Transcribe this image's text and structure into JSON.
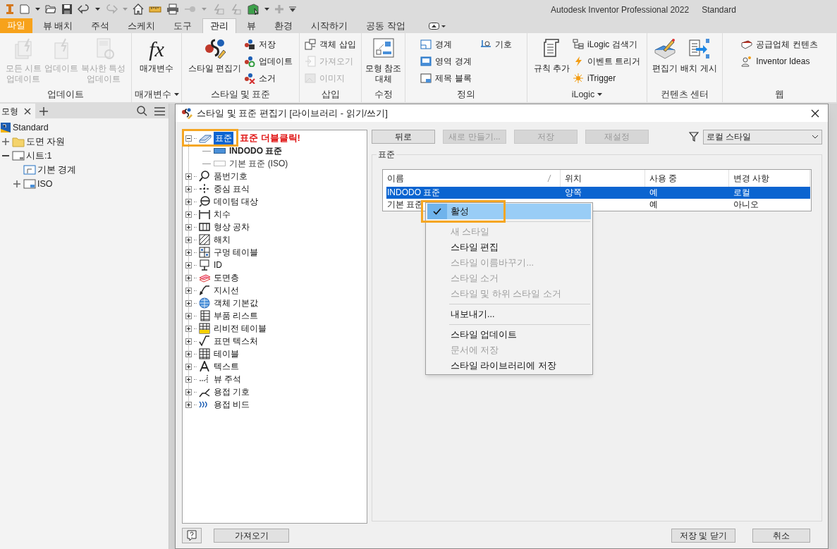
{
  "window": {
    "title": "Autodesk Inventor Professional 2022",
    "document": "Standard"
  },
  "ribbon": {
    "tabs": [
      {
        "label": "파일",
        "kind": "file",
        "selected": false
      },
      {
        "label": "뷰 배치",
        "kind": "tab",
        "selected": false
      },
      {
        "label": "주석",
        "kind": "tab",
        "selected": false
      },
      {
        "label": "스케치",
        "kind": "tab",
        "selected": false
      },
      {
        "label": "도구",
        "kind": "tab",
        "selected": false
      },
      {
        "label": "관리",
        "kind": "tab",
        "selected": true
      },
      {
        "label": "뷰",
        "kind": "tab",
        "selected": false
      },
      {
        "label": "환경",
        "kind": "tab",
        "selected": false
      },
      {
        "label": "시작하기",
        "kind": "tab",
        "selected": false
      },
      {
        "label": "공동 작업",
        "kind": "tab",
        "selected": false
      }
    ],
    "panels": [
      {
        "title": "업데이트",
        "dropdown": false,
        "tools": [
          {
            "label": "모든 시트\n업데이트",
            "kind": "large",
            "disabled": true
          },
          {
            "label": "업데이트",
            "kind": "large",
            "disabled": true
          },
          {
            "label": "복사한 특성\n업데이트",
            "kind": "large",
            "disabled": true
          }
        ]
      },
      {
        "title": "매개변수",
        "dropdown": true,
        "tools": [
          {
            "label": "매개변수",
            "kind": "large",
            "disabled": false,
            "icon_text": "fx"
          }
        ]
      },
      {
        "title": "스타일 및 표준",
        "dropdown": false,
        "tools": [
          {
            "label": "스타일 편집기",
            "kind": "large",
            "disabled": false
          },
          {
            "label": "저장",
            "kind": "small",
            "disabled": false
          },
          {
            "label": "업데이트",
            "kind": "small",
            "disabled": false
          },
          {
            "label": "소거",
            "kind": "small",
            "disabled": false
          }
        ]
      },
      {
        "title": "삽입",
        "dropdown": false,
        "tools": [
          {
            "label": "객체 삽입",
            "kind": "small",
            "disabled": false
          },
          {
            "label": "가져오기",
            "kind": "small",
            "disabled": true
          },
          {
            "label": "이미지",
            "kind": "small",
            "disabled": true
          }
        ]
      },
      {
        "title": "수정",
        "dropdown": false,
        "tools": [
          {
            "label": "모형 참조\n대체",
            "kind": "large",
            "disabled": false
          }
        ]
      },
      {
        "title": "정의",
        "dropdown": false,
        "tools": [
          {
            "label": "경계",
            "kind": "small",
            "disabled": false
          },
          {
            "label": "영역 경계",
            "kind": "small",
            "disabled": false
          },
          {
            "label": "제목 블록",
            "kind": "small",
            "disabled": false
          },
          {
            "label": "기호",
            "kind": "small",
            "disabled": false
          }
        ]
      },
      {
        "title": "iLogic",
        "dropdown": true,
        "tools": [
          {
            "label": "규칙 추가",
            "kind": "large",
            "disabled": false
          },
          {
            "label": "iLogic 검색기",
            "kind": "small",
            "disabled": false
          },
          {
            "label": "이벤트 트리거",
            "kind": "small",
            "disabled": false
          },
          {
            "label": "iTrigger",
            "kind": "small",
            "disabled": false
          }
        ]
      },
      {
        "title": "컨텐츠 센터",
        "dropdown": false,
        "tools": [
          {
            "label": "편집기",
            "kind": "large",
            "disabled": false
          },
          {
            "label": "배치 게시",
            "kind": "large",
            "disabled": false
          }
        ]
      },
      {
        "title": "웹",
        "dropdown": false,
        "tools": [
          {
            "label": "공급업체 컨텐츠",
            "kind": "small",
            "disabled": false
          },
          {
            "label": "Inventor Ideas",
            "kind": "small",
            "disabled": false
          }
        ]
      }
    ]
  },
  "browser": {
    "tab": "모형",
    "tree": [
      {
        "label": "Standard",
        "children": [
          {
            "label": "도면 자원",
            "expanded": false
          },
          {
            "label": "시트:1",
            "expanded": true,
            "children": [
              {
                "label": "기본 경계"
              },
              {
                "label": "ISO",
                "expanded": false
              }
            ]
          }
        ]
      }
    ]
  },
  "dialog": {
    "title": "스타일 및 표준 편집기 [라이브러리 - 읽기/쓰기]",
    "annotation": "표준 더블클릭!",
    "tree": [
      {
        "label": "표준",
        "expanded": true,
        "selected": true,
        "children": [
          {
            "label": "INDODO 표준",
            "active": true
          },
          {
            "label": "기본 표준 (ISO)",
            "active": false
          }
        ]
      },
      {
        "label": "품번기호",
        "expanded": false,
        "selected": false
      },
      {
        "label": "중심 표식",
        "expanded": false,
        "selected": false
      },
      {
        "label": "데이텀 대상",
        "expanded": false,
        "selected": false
      },
      {
        "label": "치수",
        "expanded": false,
        "selected": false
      },
      {
        "label": "형상 공차",
        "expanded": false,
        "selected": false
      },
      {
        "label": "해치",
        "expanded": false,
        "selected": false
      },
      {
        "label": "구멍 테이블",
        "expanded": false,
        "selected": false
      },
      {
        "label": "ID",
        "expanded": false,
        "selected": false
      },
      {
        "label": "도면층",
        "expanded": false,
        "selected": false
      },
      {
        "label": "지시선",
        "expanded": false,
        "selected": false
      },
      {
        "label": "객체 기본값",
        "expanded": false,
        "selected": false
      },
      {
        "label": "부품 리스트",
        "expanded": false,
        "selected": false
      },
      {
        "label": "리비전 테이블",
        "expanded": false,
        "selected": false
      },
      {
        "label": "표면 텍스처",
        "expanded": false,
        "selected": false
      },
      {
        "label": "테이블",
        "expanded": false,
        "selected": false
      },
      {
        "label": "텍스트",
        "expanded": false,
        "selected": false
      },
      {
        "label": "뷰 주석",
        "expanded": false,
        "selected": false
      },
      {
        "label": "용접 기호",
        "expanded": false,
        "selected": false
      },
      {
        "label": "용접 비드",
        "expanded": false,
        "selected": false
      }
    ],
    "buttons": [
      {
        "label": "뒤로",
        "disabled": false
      },
      {
        "label": "새로 만들기...",
        "disabled": true
      },
      {
        "label": "저장",
        "disabled": true
      },
      {
        "label": "재설정",
        "disabled": true
      }
    ],
    "filter": {
      "value": "로컬 스타일"
    },
    "group_title": "표준",
    "table": {
      "columns": [
        "이름",
        "위치",
        "사용 중",
        "변경 사항"
      ],
      "rows": [
        {
          "name": "INDODO 표준",
          "location": "양쪽",
          "in_use": "예",
          "changes": "로컬",
          "selected": true
        },
        {
          "name": "기본 표준",
          "in_use": "예",
          "changes": "아니오",
          "selected": false
        }
      ]
    },
    "context_menu": [
      {
        "kind": "item",
        "label": "활성",
        "checked": true,
        "disabled": false,
        "highlighted": true
      },
      {
        "kind": "separator"
      },
      {
        "kind": "item",
        "label": "새 스타일",
        "checked": false,
        "disabled": true,
        "highlighted": false
      },
      {
        "kind": "item",
        "label": "스타일 편집",
        "checked": false,
        "disabled": false,
        "highlighted": false
      },
      {
        "kind": "item",
        "label": "스타일 이름바꾸기...",
        "checked": false,
        "disabled": true,
        "highlighted": false
      },
      {
        "kind": "item",
        "label": "스타일 소거",
        "checked": false,
        "disabled": true,
        "highlighted": false
      },
      {
        "kind": "item",
        "label": "스타일 및 하위 스타일 소거",
        "checked": false,
        "disabled": true,
        "highlighted": false
      },
      {
        "kind": "separator"
      },
      {
        "kind": "item",
        "label": "내보내기...",
        "checked": false,
        "disabled": false,
        "highlighted": false
      },
      {
        "kind": "separator"
      },
      {
        "kind": "item",
        "label": "스타일 업데이트",
        "checked": false,
        "disabled": false,
        "highlighted": false
      },
      {
        "kind": "item",
        "label": "문서에 저장",
        "checked": false,
        "disabled": true,
        "highlighted": false
      },
      {
        "kind": "item",
        "label": "스타일 라이브러리에 저장",
        "checked": false,
        "disabled": false,
        "highlighted": false
      }
    ],
    "footer": {
      "left_buttons": [
        "가져오기"
      ],
      "right_buttons": [
        "저장 및 닫기",
        "취소"
      ]
    }
  }
}
